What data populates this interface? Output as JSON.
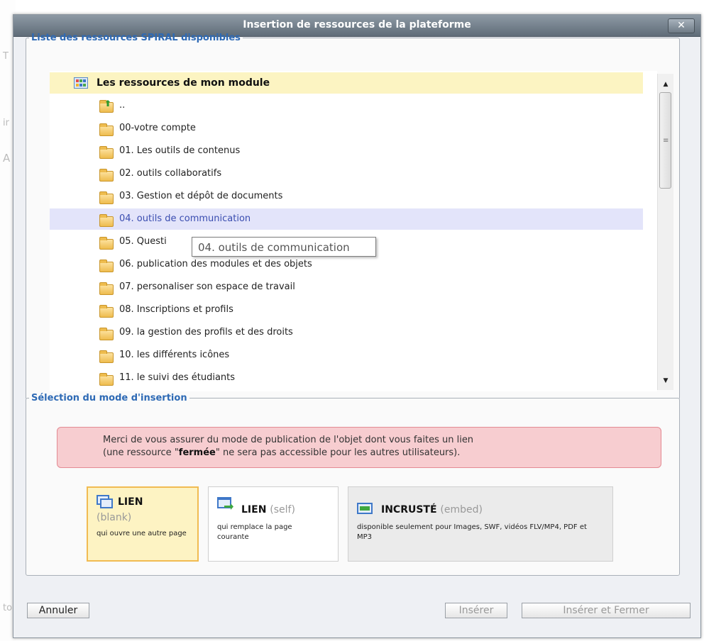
{
  "dialog": {
    "title": "Insertion de ressources de la plateforme",
    "close_label": "✕"
  },
  "resources": {
    "legend": "Liste des ressources SPIRAL disponibles",
    "root_label": "Les ressources de mon module",
    "items": [
      {
        "label": ".."
      },
      {
        "label": "00-votre compte"
      },
      {
        "label": "01. Les outils de contenus"
      },
      {
        "label": "02. outils collaboratifs"
      },
      {
        "label": "03. Gestion et dépôt de documents"
      },
      {
        "label": "04. outils de communication"
      },
      {
        "label": "05. Questi"
      },
      {
        "label": "06. publication des modules et des objets"
      },
      {
        "label": "07. personaliser son espace de travail"
      },
      {
        "label": "08. Inscriptions et profils"
      },
      {
        "label": "09. la gestion des profils et des droits"
      },
      {
        "label": "10. les différents icônes"
      },
      {
        "label": "11. le suivi des étudiants"
      }
    ],
    "hovered_index": 5,
    "tooltip": "04. outils de communication"
  },
  "insertion": {
    "legend": "Sélection du mode d'insertion",
    "warning_line1": "Merci de vous assurer du mode de publication de l'objet dont vous faites un lien",
    "warning_prefix": "(une ressource \"",
    "warning_bold": "fermée",
    "warning_suffix": "\" ne sera pas accessible pour les autres utilisateurs).",
    "modes": {
      "blank": {
        "title": "LIEN",
        "subtitle": "(blank)",
        "desc": "qui ouvre une autre page"
      },
      "self": {
        "title": "LIEN",
        "subtitle": "(self)",
        "desc": "qui remplace la page courante"
      },
      "embed": {
        "title": "INCRUSTÉ",
        "subtitle": "(embed)",
        "desc": "disponible seulement pour Images, SWF, vidéos FLV/MP4, PDF et MP3"
      }
    }
  },
  "buttons": {
    "cancel": "Annuler",
    "insert": "Insérer",
    "insert_close": "Insérer et Fermer"
  },
  "background_edge": [
    "T",
    "ir",
    "A",
    "to"
  ]
}
